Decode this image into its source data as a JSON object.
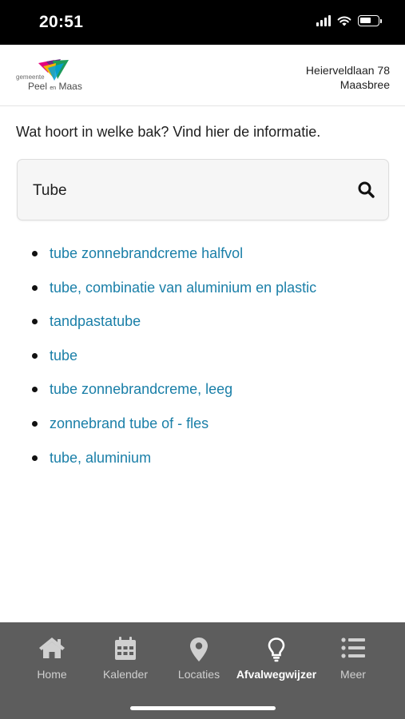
{
  "status_bar": {
    "time": "20:51"
  },
  "header": {
    "logo": {
      "small_text": "gemeente",
      "name_first": "Peel",
      "name_mid": "en",
      "name_last": "Maas"
    },
    "address_line1": "Heierveldlaan 78",
    "address_line2": "Maasbree"
  },
  "intro_text": "Wat hoort in welke bak? Vind hier de informatie.",
  "search": {
    "value": "Tube"
  },
  "results": [
    {
      "label": "tube zonnebrandcreme halfvol"
    },
    {
      "label": "tube, combinatie van aluminium en plastic"
    },
    {
      "label": "tandpastatube"
    },
    {
      "label": "tube"
    },
    {
      "label": "tube zonnebrandcreme, leeg"
    },
    {
      "label": "zonnebrand tube of - fles"
    },
    {
      "label": "tube, aluminium"
    }
  ],
  "tab_bar": {
    "active_tab": "Afvalwegwijzer",
    "tabs": [
      {
        "label": "Home",
        "icon": "home-icon"
      },
      {
        "label": "Kalender",
        "icon": "calendar-icon"
      },
      {
        "label": "Locaties",
        "icon": "map-pin-icon"
      },
      {
        "label": "Afvalwegwijzer",
        "icon": "lightbulb-icon"
      },
      {
        "label": "Meer",
        "icon": "list-icon"
      }
    ]
  },
  "colors": {
    "link": "#1a7fa8",
    "tab_bar_bg": "#5d5d5d",
    "status_bar_bg": "#000000"
  }
}
